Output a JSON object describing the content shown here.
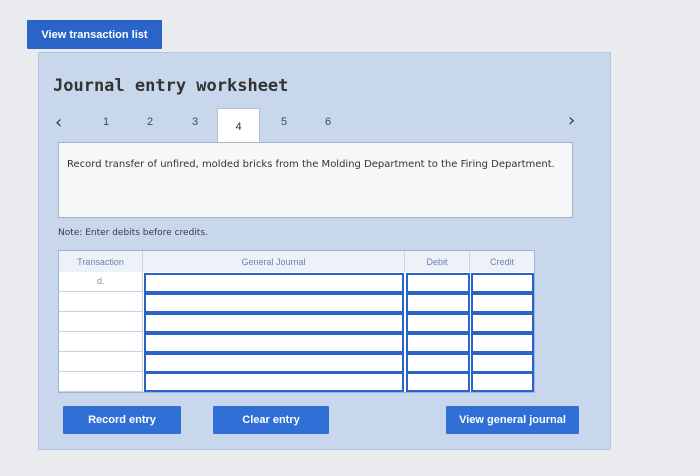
{
  "toolbar": {
    "view_transaction_list": "View transaction list"
  },
  "worksheet": {
    "title": "Journal entry worksheet",
    "tabs": [
      "1",
      "2",
      "3",
      "4",
      "5",
      "6"
    ],
    "active_tab": "4",
    "prompt": "Record transfer of unfired, molded bricks from the Molding Department to the Firing Department.",
    "note": "Note: Enter debits before credits."
  },
  "table": {
    "headers": {
      "transaction": "Transaction",
      "general_journal": "General Journal",
      "debit": "Debit",
      "credit": "Credit"
    },
    "rows": [
      {
        "transaction": "d.",
        "account": "",
        "debit": "",
        "credit": ""
      },
      {
        "transaction": "",
        "account": "",
        "debit": "",
        "credit": ""
      },
      {
        "transaction": "",
        "account": "",
        "debit": "",
        "credit": ""
      },
      {
        "transaction": "",
        "account": "",
        "debit": "",
        "credit": ""
      },
      {
        "transaction": "",
        "account": "",
        "debit": "",
        "credit": ""
      },
      {
        "transaction": "",
        "account": "",
        "debit": "",
        "credit": ""
      }
    ]
  },
  "buttons": {
    "record_entry": "Record entry",
    "clear_entry": "Clear entry",
    "view_general_journal": "View general journal"
  },
  "colors": {
    "accent": "#2f6fd6",
    "panel": "#c9d7ec",
    "input_border": "#2a64c8"
  }
}
